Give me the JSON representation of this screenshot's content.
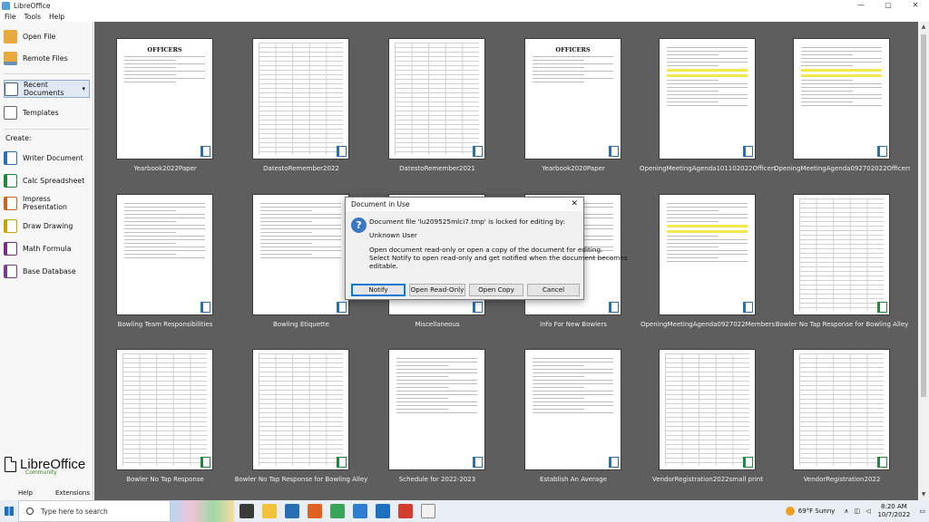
{
  "window": {
    "title": "LibreOffice",
    "minimize": "—",
    "maximize": "▢",
    "close": "✕"
  },
  "menu": [
    "File",
    "Tools",
    "Help"
  ],
  "sidebar": {
    "open_file": "Open File",
    "remote_files": "Remote Files",
    "recent_documents": "Recent Documents",
    "templates": "Templates",
    "create_heading": "Create:",
    "create": [
      "Writer Document",
      "Calc Spreadsheet",
      "Impress Presentation",
      "Draw Drawing",
      "Math Formula",
      "Base Database"
    ],
    "logo_text": "LibreOffice",
    "logo_sub": "Community",
    "help": "Help",
    "extensions": "Extensions"
  },
  "recent": [
    {
      "name": "Yearbook2022Paper",
      "kind": "writer",
      "preview": "officers",
      "heading": "OFFICERS"
    },
    {
      "name": "DatestoRemember2022",
      "kind": "writer",
      "preview": "dates"
    },
    {
      "name": "DatestoRemember2021",
      "kind": "writer",
      "preview": "dates"
    },
    {
      "name": "Yearbook2020Paper",
      "kind": "writer",
      "preview": "officers",
      "heading": "OFFICERS"
    },
    {
      "name": "OpeningMeetingAgenda101102022Officers",
      "kind": "writer",
      "preview": "agenda"
    },
    {
      "name": "OpeningMeetingAgenda092702022Officers",
      "kind": "writer",
      "preview": "agenda"
    },
    {
      "name": "Bowling Team Responsibilities",
      "kind": "writer",
      "preview": "text"
    },
    {
      "name": "Bowling Etiquette",
      "kind": "writer",
      "preview": "text"
    },
    {
      "name": "Miscellaneous",
      "kind": "writer",
      "preview": "text"
    },
    {
      "name": "Info For New Bowlers",
      "kind": "writer",
      "preview": "text"
    },
    {
      "name": "OpeningMeetingAgenda0927022Members",
      "kind": "writer",
      "preview": "agenda"
    },
    {
      "name": "Bowler No Tap Response for Bowling Alley",
      "kind": "calc",
      "preview": "table"
    },
    {
      "name": "Bowler No Tap Response",
      "kind": "calc",
      "preview": "table"
    },
    {
      "name": "Bowler No Tap Response for Bowling Alley",
      "kind": "calc",
      "preview": "table"
    },
    {
      "name": "Schedule for 2022-2023",
      "kind": "writer",
      "preview": "text"
    },
    {
      "name": "Establish An Average",
      "kind": "writer",
      "preview": "text"
    },
    {
      "name": "VendorRegistration2022small print",
      "kind": "calc",
      "preview": "table"
    },
    {
      "name": "VendorRegistration2022",
      "kind": "calc",
      "preview": "table"
    }
  ],
  "dialog": {
    "title": "Document in Use",
    "line1": "Document file 'lu209525mlci7.tmp' is locked for editing by:",
    "line2": "Unknown User",
    "line3": "Open document read-only or open a copy of the document for editing.",
    "line4": "Select Notify to open read-only and get notified when the document becomes",
    "line5": "editable.",
    "buttons": [
      "Notify",
      "Open Read-Only",
      "Open Copy",
      "Cancel"
    ]
  },
  "taskbar": {
    "search_placeholder": "Type here to search",
    "weather": "69°F  Sunny",
    "time": "8:20 AM",
    "date": "10/7/2022"
  },
  "colors": {
    "grid_bg": "#5e5e5e",
    "dialog_default": "#0078d7"
  }
}
